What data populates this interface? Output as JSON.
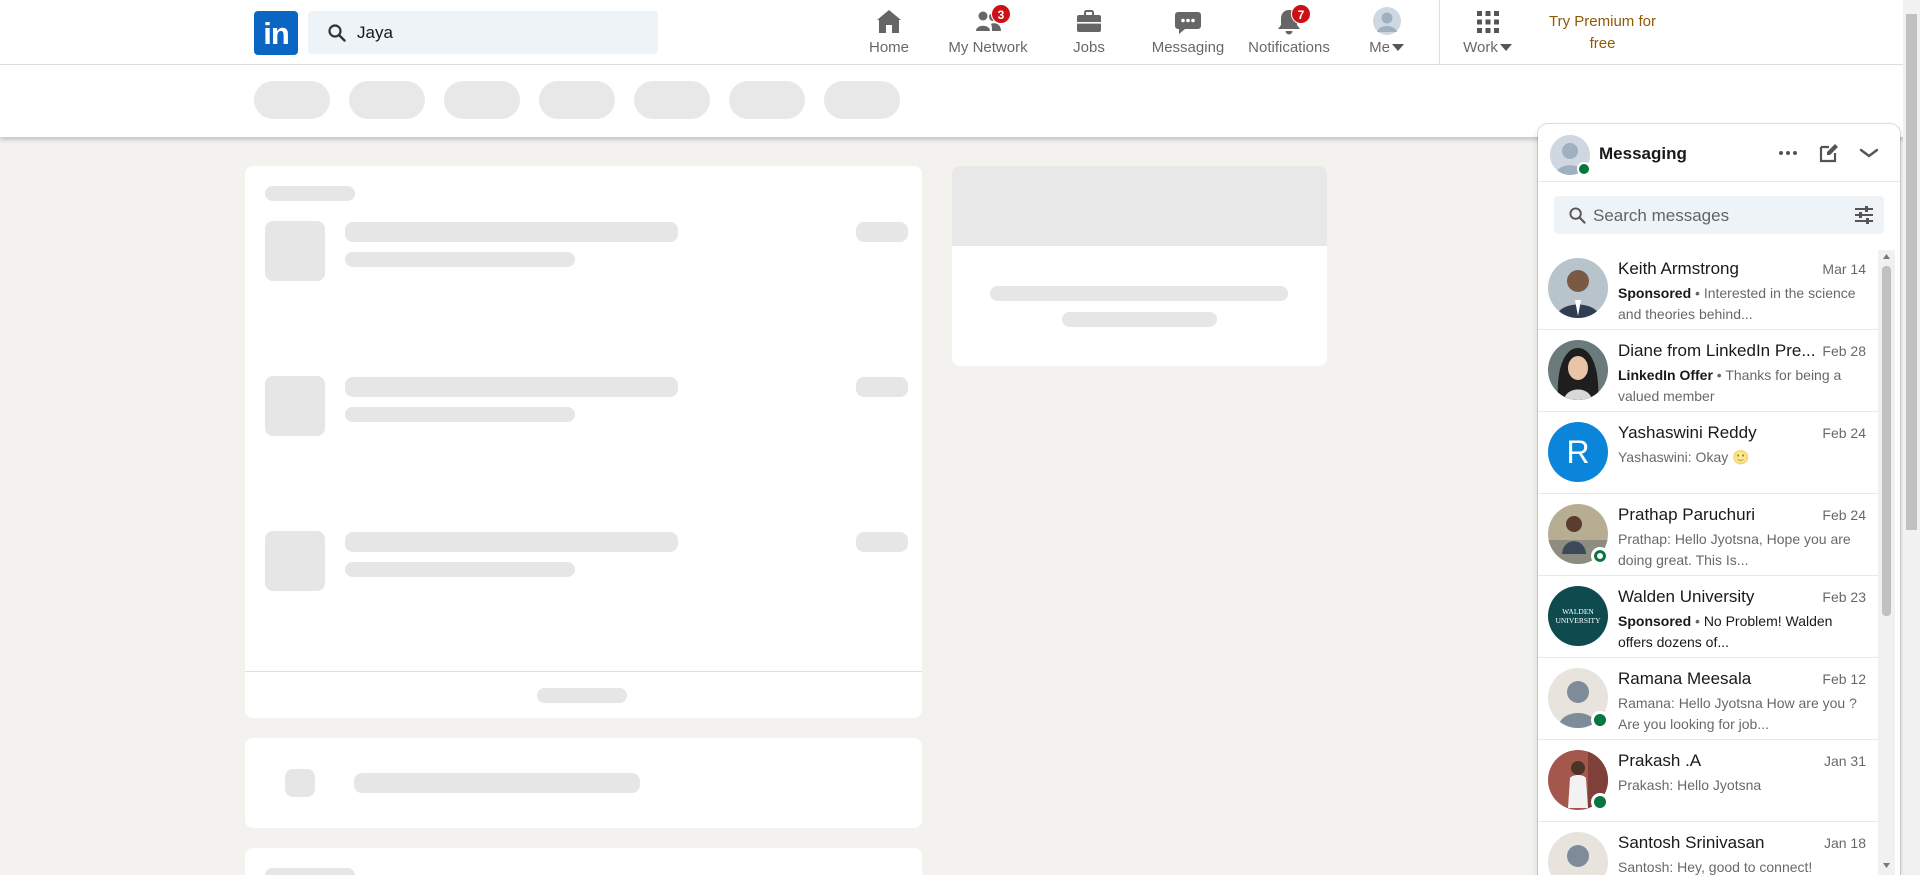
{
  "nav": {
    "logo_text": "in",
    "search_value": "Jaya",
    "items": [
      {
        "label": "Home",
        "icon": "home-icon"
      },
      {
        "label": "My Network",
        "icon": "network-icon",
        "badge": "3"
      },
      {
        "label": "Jobs",
        "icon": "briefcase-icon"
      },
      {
        "label": "Messaging",
        "icon": "messaging-icon"
      },
      {
        "label": "Notifications",
        "icon": "bell-icon",
        "badge": "7"
      },
      {
        "label": "Me",
        "icon": "avatar-icon"
      },
      {
        "label": "Work",
        "icon": "grid-icon"
      }
    ],
    "premium": "Try Premium for free"
  },
  "messaging": {
    "title": "Messaging",
    "search_placeholder": "Search messages",
    "conversations": [
      {
        "name": "Keith Armstrong",
        "date": "Mar 14",
        "tag": "Sponsored",
        "preview": "Interested in the science and theories behind...",
        "avatar_color": "#5a6b7d",
        "status": "none"
      },
      {
        "name": "Diane from LinkedIn Pre...",
        "date": "Feb 28",
        "tag": "LinkedIn Offer",
        "preview": "Thanks for being a valued member",
        "avatar_color": "#3b3b3b",
        "status": "none"
      },
      {
        "name": "Yashaswini Reddy",
        "date": "Feb 24",
        "tag": "",
        "preview": "Yashaswini: Okay 🙂",
        "avatar_color": "#0a85d9",
        "avatar_letter": "R",
        "status": "none"
      },
      {
        "name": "Prathap Paruchuri",
        "date": "Feb 24",
        "tag": "",
        "preview": "Prathap: Hello Jyotsna, Hope you are doing great. This Is...",
        "avatar_color": "#8a7f6d",
        "status": "ring"
      },
      {
        "name": "Walden University",
        "date": "Feb 23",
        "tag": "Sponsored",
        "preview": "No Problem! Walden offers dozens of...",
        "avatar_color": "#0f4a4f",
        "avatar_letter": "WALDEN UNIVERSITY",
        "status": "none"
      },
      {
        "name": "Ramana Meesala",
        "date": "Feb 12",
        "tag": "",
        "preview": "Ramana: Hello Jyotsna How are you ? Are you looking for job...",
        "avatar_color": "#cfd8e0",
        "status": "online"
      },
      {
        "name": "Prakash .A",
        "date": "Jan 31",
        "tag": "",
        "preview": "Prakash: Hello Jyotsna",
        "avatar_color": "#8c5048",
        "status": "online"
      },
      {
        "name": "Santosh Srinivasan",
        "date": "Jan 18",
        "tag": "",
        "preview": "Santosh: Hey, good to connect!",
        "avatar_color": "#cfd8e0",
        "status": "none"
      }
    ]
  }
}
